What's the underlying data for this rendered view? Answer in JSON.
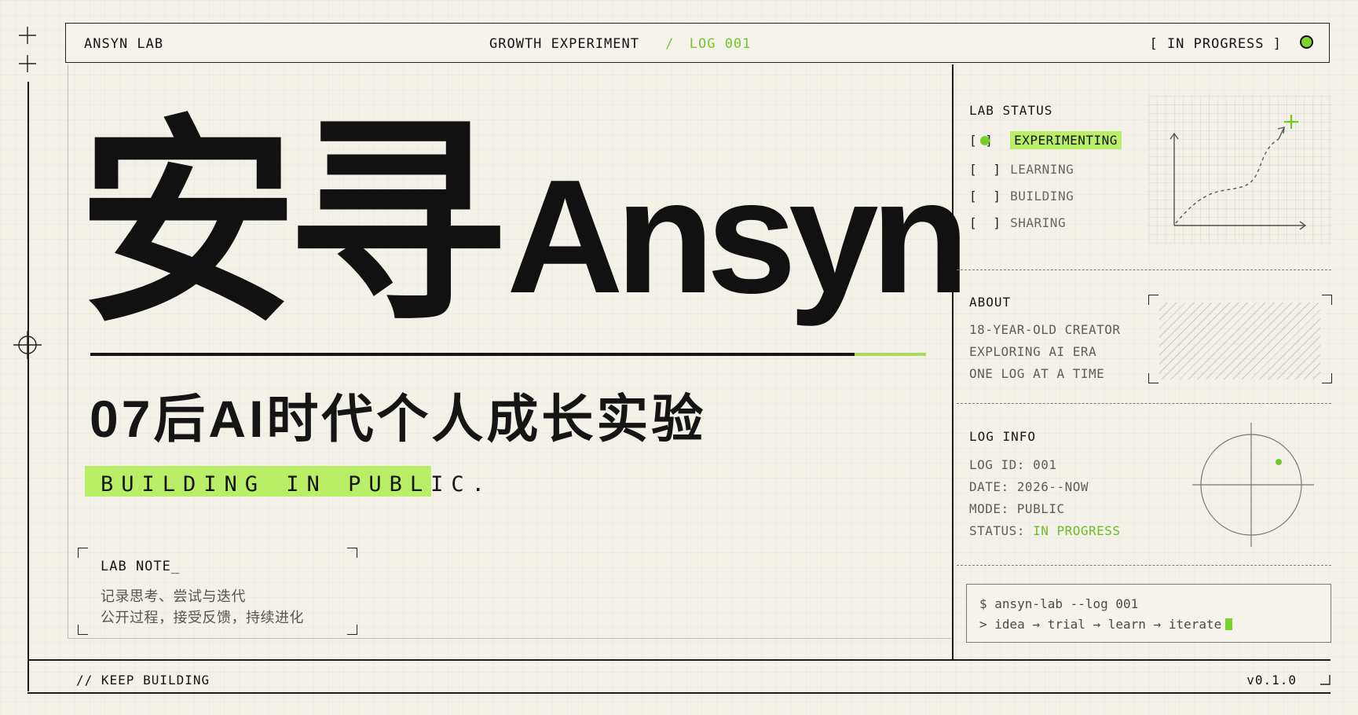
{
  "header": {
    "left_label": "ANSYN LAB",
    "center_label": "GROWTH EXPERIMENT",
    "center_separator": "/",
    "log_label": "LOG 001",
    "status_label": "[ IN PROGRESS ]"
  },
  "hero": {
    "chinese_name": "安寻",
    "latin_name": "Ansyn",
    "subtitle": "07后AI时代个人成长实验",
    "highlight": "BUILDING IN PUBLIC."
  },
  "lab_note": {
    "title": "LAB NOTE_",
    "line_1": "记录思考、尝试与迭代",
    "line_2": "公开过程，接受反馈，持续进化"
  },
  "footer": {
    "left": "// KEEP BUILDING",
    "right": "v0.1.0"
  },
  "lab_status": {
    "title": "LAB STATUS",
    "items": [
      {
        "label": "EXPERIMENTING",
        "active": true
      },
      {
        "label": "LEARNING",
        "active": false
      },
      {
        "label": "BUILDING",
        "active": false
      },
      {
        "label": "SHARING",
        "active": false
      }
    ]
  },
  "about": {
    "title": "ABOUT",
    "lines": [
      "18-YEAR-OLD CREATOR",
      "EXPLORING AI ERA",
      "ONE LOG AT A TIME"
    ]
  },
  "log_info": {
    "title": "LOG INFO",
    "rows": [
      {
        "label": "LOG ID: ",
        "value": "001"
      },
      {
        "label": "DATE: ",
        "value": "2026--NOW"
      },
      {
        "label": "MODE: ",
        "value": "PUBLIC"
      },
      {
        "label": "STATUS: ",
        "value": "IN PROGRESS"
      }
    ]
  },
  "terminal": {
    "command": "$ ansyn-lab --log 001",
    "flow": "> idea → trial → learn → iterate"
  },
  "colors": {
    "accent": "#b9ef66",
    "accent_dark": "#72c82b",
    "ink": "#151515",
    "paper": "#f3f1e8"
  },
  "icons": {
    "status_indicator": "green-dot-icon",
    "chart_decoration": "growth-chart-icon",
    "target_decoration": "crosshair-target-icon",
    "edge_markers": "plus-crosshair-icon"
  }
}
